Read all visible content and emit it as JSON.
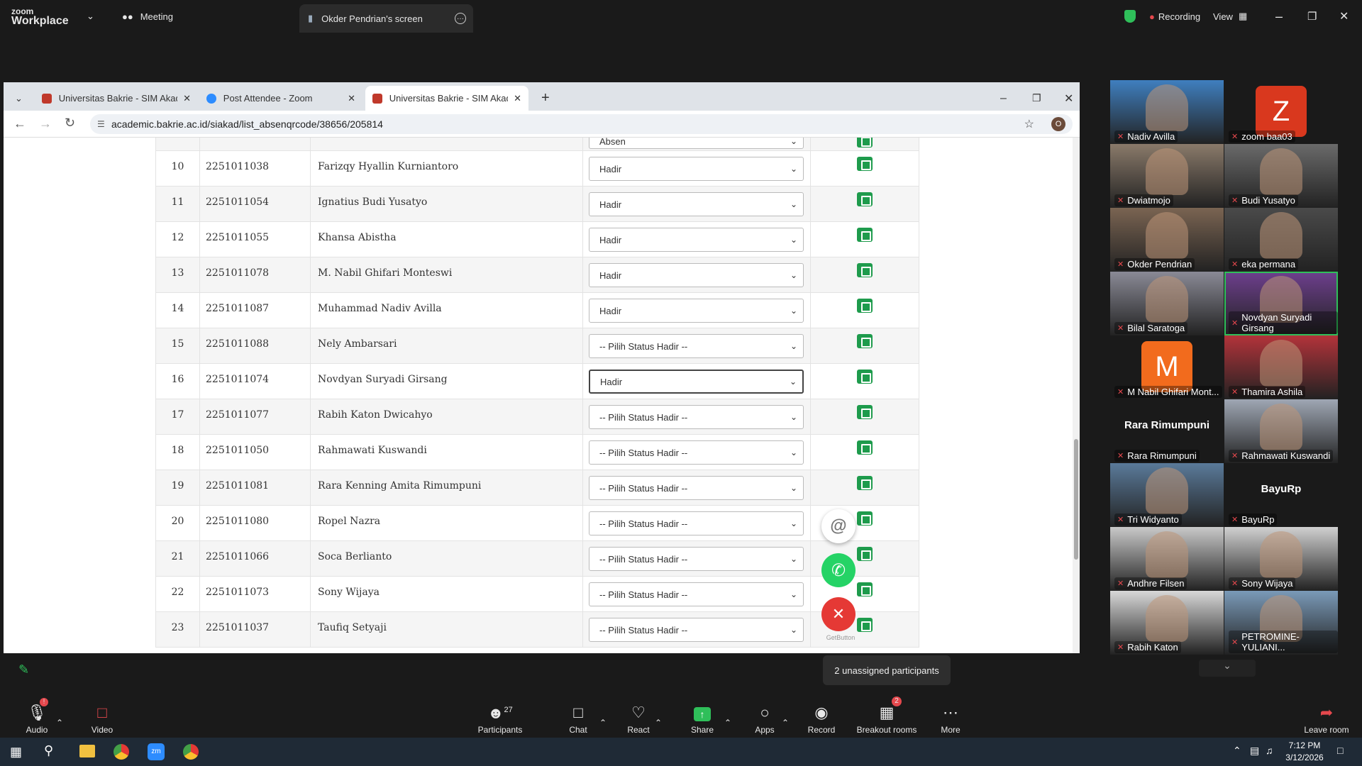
{
  "zoom": {
    "logo_line1": "zoom",
    "logo_line2": "Workplace",
    "meeting_label": "Meeting",
    "share_tab": "Okder Pendrian's screen",
    "recording_label": "Recording",
    "view_label": "View"
  },
  "browser": {
    "tabs": [
      {
        "title": "Universitas Bakrie - SIM Akade",
        "favicon_color": "#c0392b"
      },
      {
        "title": "Post Attendee - Zoom",
        "favicon_color": "#2d8cff"
      },
      {
        "title": "Universitas Bakrie - SIM Akade",
        "favicon_color": "#c0392b"
      }
    ],
    "url": "academic.bakrie.ac.id/siakad/list_absenqrcode/38656/205814",
    "profile_initial": "O"
  },
  "attendance": {
    "partial_row_status": "Absen",
    "rows": [
      {
        "no": "10",
        "nim": "2251011038",
        "name": "Farizqy Hyallin Kurniantoro",
        "status": "Hadir"
      },
      {
        "no": "11",
        "nim": "2251011054",
        "name": "Ignatius Budi Yusatyo",
        "status": "Hadir"
      },
      {
        "no": "12",
        "nim": "2251011055",
        "name": "Khansa Abistha",
        "status": "Hadir"
      },
      {
        "no": "13",
        "nim": "2251011078",
        "name": "M. Nabil Ghifari Monteswi",
        "status": "Hadir"
      },
      {
        "no": "14",
        "nim": "2251011087",
        "name": "Muhammad Nadiv Avilla",
        "status": "Hadir"
      },
      {
        "no": "15",
        "nim": "2251011088",
        "name": "Nely Ambarsari",
        "status": "-- Pilih Status Hadir --"
      },
      {
        "no": "16",
        "nim": "2251011074",
        "name": "Novdyan Suryadi Girsang",
        "status": "Hadir"
      },
      {
        "no": "17",
        "nim": "2251011077",
        "name": "Rabih Katon Dwicahyo",
        "status": "-- Pilih Status Hadir --"
      },
      {
        "no": "18",
        "nim": "2251011050",
        "name": "Rahmawati Kuswandi",
        "status": "-- Pilih Status Hadir --"
      },
      {
        "no": "19",
        "nim": "2251011081",
        "name": "Rara Kenning Amita Rimumpuni",
        "status": "-- Pilih Status Hadir --"
      },
      {
        "no": "20",
        "nim": "2251011080",
        "name": "Ropel Nazra",
        "status": "-- Pilih Status Hadir --"
      },
      {
        "no": "21",
        "nim": "2251011066",
        "name": "Soca Berlianto",
        "status": "-- Pilih Status Hadir --"
      },
      {
        "no": "22",
        "nim": "2251011073",
        "name": "Sony Wijaya",
        "status": "-- Pilih Status Hadir --"
      },
      {
        "no": "23",
        "nim": "2251011037",
        "name": "Taufiq Setyaji",
        "status": "-- Pilih Status Hadir --"
      }
    ]
  },
  "getbutton_label": "GetButton",
  "participants": [
    {
      "name": "Nadiv Avilla",
      "kind": "photo",
      "color": "#3f7fbf"
    },
    {
      "name": "zoom baa03",
      "kind": "letter",
      "letter": "Z",
      "color": "#d9381e"
    },
    {
      "name": "Dwiatmojo",
      "kind": "photo",
      "color": "#8a7a6a"
    },
    {
      "name": "Budi Yusatyo",
      "kind": "photo",
      "color": "#6a6a6a"
    },
    {
      "name": "Okder Pendrian",
      "kind": "photo",
      "color": "#7a6452"
    },
    {
      "name": "eka permana",
      "kind": "photo",
      "color": "#4a4a4a"
    },
    {
      "name": "Bilal Saratoga",
      "kind": "photo",
      "color": "#8a8a96"
    },
    {
      "name": "Novdyan Suryadi Girsang",
      "kind": "photo",
      "color": "#6e3f8e"
    },
    {
      "name": "M Nabil Ghifari Mont...",
      "kind": "letter",
      "letter": "M",
      "color": "#f26b1d"
    },
    {
      "name": "Thamira Ashila",
      "kind": "photo",
      "color": "#b3333a"
    },
    {
      "name": "Rara Rimumpuni",
      "kind": "name",
      "display": "Rara Rimumpuni"
    },
    {
      "name": "Rahmawati Kuswandi",
      "kind": "photo",
      "color": "#9fa7b4"
    },
    {
      "name": "Tri Widyanto",
      "kind": "photo",
      "color": "#5a7a9a"
    },
    {
      "name": "BayuRp",
      "kind": "name",
      "display": "BayuRp"
    },
    {
      "name": "Andhre Filsen",
      "kind": "photo",
      "color": "#c9c9c9"
    },
    {
      "name": "Sony Wijaya",
      "kind": "photo",
      "color": "#d0d0d0"
    },
    {
      "name": "Rabih Katon",
      "kind": "photo",
      "color": "#d8d8d8"
    },
    {
      "name": "PETROMINE-YULIANI...",
      "kind": "photo",
      "color": "#7a9ab8"
    }
  ],
  "unassigned_text": "2 unassigned participants",
  "toolbar": {
    "audio": "Audio",
    "video": "Video",
    "participants": "Participants",
    "participants_count": "27",
    "chat": "Chat",
    "react": "React",
    "share": "Share",
    "apps": "Apps",
    "record": "Record",
    "breakout": "Breakout rooms",
    "breakout_badge": "2",
    "more": "More",
    "leave": "Leave room",
    "audio_badge": "!"
  },
  "taskbar": {
    "time": "7:12 PM",
    "date": "3/12/2026"
  }
}
